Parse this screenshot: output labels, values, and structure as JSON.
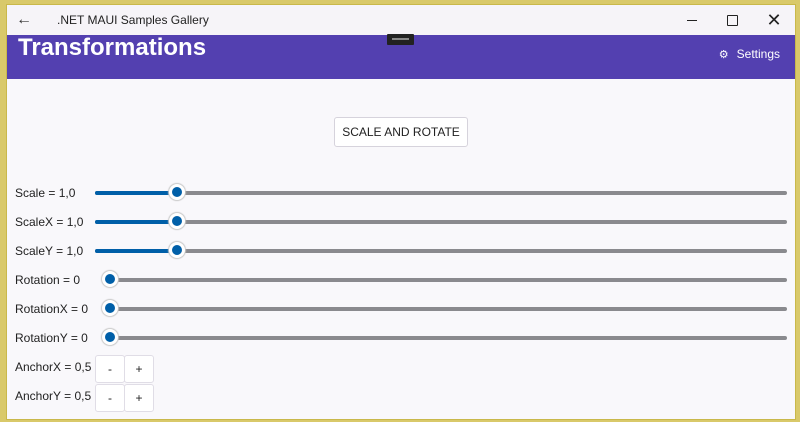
{
  "window": {
    "back_glyph": "←",
    "app_title": ".NET MAUI Samples Gallery",
    "minimize_glyph": "—",
    "close_glyph": "✕"
  },
  "header": {
    "title": "Transformations",
    "settings_label": "Settings",
    "background": "#5340b0"
  },
  "main": {
    "action_button": "SCALE AND ROTATE",
    "sliders": [
      {
        "label": "Scale = 1,0",
        "value_fraction": 0.11
      },
      {
        "label": "ScaleX = 1,0",
        "value_fraction": 0.11
      },
      {
        "label": "ScaleY = 1,0",
        "value_fraction": 0.11
      },
      {
        "label": "Rotation = 0",
        "value_fraction": 0
      },
      {
        "label": "RotationX = 0",
        "value_fraction": 0
      },
      {
        "label": "RotationY = 0",
        "value_fraction": 0
      }
    ],
    "steppers": [
      {
        "label": "AnchorX = 0,5",
        "minus": "-",
        "plus": "+"
      },
      {
        "label": "AnchorY = 0,5",
        "minus": "-",
        "plus": "+"
      }
    ]
  },
  "colors": {
    "slider_fill": "#005fa8",
    "slider_track": "#8a8a8e"
  }
}
